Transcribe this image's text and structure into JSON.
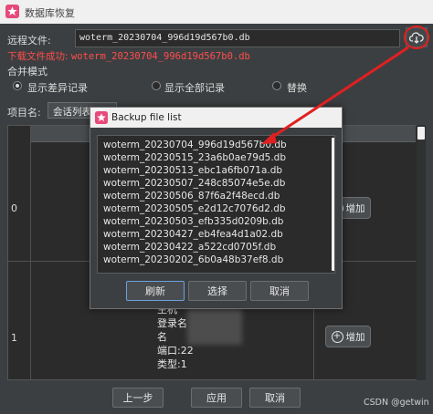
{
  "window": {
    "title": "数据库恢复",
    "remote_file_label": "远程文件:",
    "remote_file_value": "woterm_20230704_996d19d567b0.db",
    "download_status_prefix": "下载文件成功:",
    "download_status_file": "woterm_20230704_996d19d567b0.db"
  },
  "merge": {
    "label": "合并模式",
    "options": [
      "显示差异记录",
      "显示全部记录",
      "替换"
    ],
    "selected_index": 0
  },
  "item": {
    "label": "项目名:",
    "value": "会话列表"
  },
  "table": {
    "rows": [
      {
        "index": "0",
        "add_label": "增加"
      },
      {
        "index": "1",
        "add_label": "增加",
        "info": [
          "主机",
          "登录名",
          "名",
          "端口:22",
          "类型:1"
        ]
      }
    ]
  },
  "footer": {
    "prev": "上一步",
    "apply": "应用",
    "cancel": "取消"
  },
  "dialog": {
    "title": "Backup file list",
    "files": [
      "woterm_20230704_996d19d567b0.db",
      "woterm_20230515_23a6b0ae79d5.db",
      "woterm_20230513_ebc1a6fb071a.db",
      "woterm_20230507_248c85074e5e.db",
      "woterm_20230506_87f6a2f48ecd.db",
      "woterm_20230505_e2d12c7076d2.db",
      "woterm_20230503_efb335d0209b.db",
      "woterm_20230427_eb4fea4d1a02.db",
      "woterm_20230422_a522cd0705f.db",
      "woterm_20230202_6b0a48b37ef8.db"
    ],
    "refresh": "刷新",
    "select": "选择",
    "cancel": "取消"
  },
  "watermark": "CSDN @getwin",
  "colors": {
    "error_text": "#ff4d4d",
    "annotation_arrow": "#e02020"
  }
}
